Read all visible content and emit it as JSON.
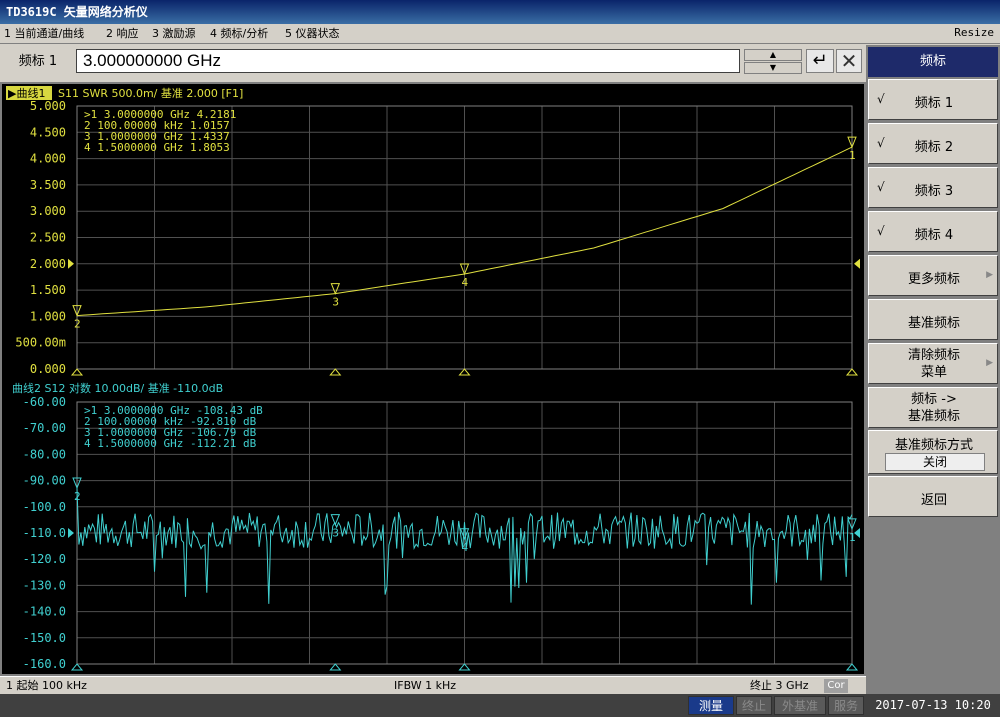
{
  "window": {
    "title": "TD3619C 矢量网络分析仪"
  },
  "menu": {
    "items": [
      "1 当前通道/曲线",
      "2 响应",
      "3 激励源",
      "4 频标/分析",
      "5 仪器状态"
    ],
    "resize": "Resize"
  },
  "entry": {
    "label": "频标 1",
    "value": "3.000000000 GHz"
  },
  "trace1": {
    "header_tag": "▶曲线1",
    "header": "S11 SWR 500.0m/ 基准 2.000 [F1]",
    "y_ticks": [
      "5.000",
      "4.500",
      "4.000",
      "3.500",
      "3.000",
      "2.500",
      "2.000",
      "1.500",
      "1.000",
      "500.00m",
      "0.000"
    ],
    "markers": [
      {
        "id": ">1",
        "freq": "3.0000000 GHz",
        "value": "4.2181"
      },
      {
        "id": "2",
        "freq": "100.00000 kHz",
        "value": "1.0157"
      },
      {
        "id": "3",
        "freq": "1.0000000 GHz",
        "value": "1.4337"
      },
      {
        "id": "4",
        "freq": "1.5000000 GHz",
        "value": "1.8053"
      }
    ],
    "marker_labels": [
      "1",
      "2",
      "3",
      "4"
    ],
    "color": "#e0e040"
  },
  "trace2": {
    "header": "曲线2 S12 对数 10.00dB/ 基准 -110.0dB",
    "y_ticks": [
      "-60.00",
      "-70.00",
      "-80.00",
      "-90.00",
      "-100.0",
      "-110.0",
      "-120.0",
      "-130.0",
      "-140.0",
      "-150.0",
      "-160.0"
    ],
    "markers": [
      {
        "id": ">1",
        "freq": "3.0000000 GHz",
        "value": "-108.43 dB"
      },
      {
        "id": "2",
        "freq": "100.00000 kHz",
        "value": "-92.810 dB"
      },
      {
        "id": "3",
        "freq": "1.0000000 GHz",
        "value": "-106.79 dB"
      },
      {
        "id": "4",
        "freq": "1.5000000 GHz",
        "value": "-112.21 dB"
      }
    ],
    "marker_labels": [
      "1",
      "2",
      "3",
      "4"
    ],
    "color": "#40d0d0"
  },
  "chart_data": [
    {
      "type": "line",
      "title": "S11 SWR 500.0m/ 基准 2.000 [F1]",
      "x_range_hz": [
        100000,
        3000000000
      ],
      "ylim": [
        0,
        5
      ],
      "series": [
        {
          "name": "曲线1",
          "x": [
            100000,
            500000000,
            1000000000,
            1500000000,
            2000000000,
            2500000000,
            3000000000
          ],
          "values": [
            1.0157,
            1.18,
            1.4337,
            1.8053,
            2.3,
            3.05,
            4.2181
          ]
        }
      ],
      "grid": true
    },
    {
      "type": "line",
      "title": "S12 对数 10.00dB/ 基准 -110.0dB",
      "x_range_hz": [
        100000,
        3000000000
      ],
      "ylim": [
        -160,
        -60
      ],
      "series": [
        {
          "name": "曲线2",
          "x": [
            100000,
            1000000000,
            1500000000,
            3000000000
          ],
          "values": [
            -92.81,
            -106.79,
            -112.21,
            -108.43
          ]
        }
      ],
      "grid": true
    }
  ],
  "status": {
    "start": "1 起始 100 kHz",
    "ifbw": "IFBW 1 kHz",
    "stop": "终止 3 GHz",
    "cor": "Cor"
  },
  "bottom": {
    "items": [
      "测量",
      "终止",
      "外基准",
      "服务"
    ],
    "clock": "2017-07-13 10:20"
  },
  "softkeys": {
    "title": "频标",
    "marker1": "频标 1",
    "marker2": "频标 2",
    "marker3": "频标 3",
    "marker4": "频标 4",
    "more": "更多频标",
    "ref": "基准频标",
    "clear_line1": "清除频标",
    "clear_line2": "菜单",
    "to_ref_line1": "频标 ->",
    "to_ref_line2": "基准频标",
    "ref_mode": "基准频标方式",
    "ref_mode_value": "关闭",
    "back": "返回",
    "check": "√"
  }
}
